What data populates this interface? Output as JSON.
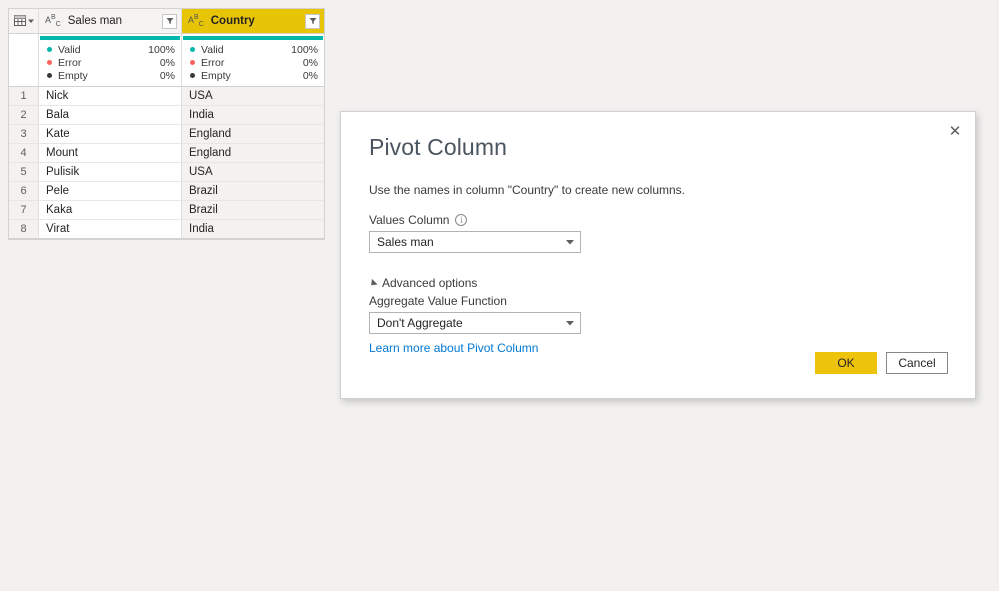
{
  "grid": {
    "table_icon_name": "table-icon",
    "columns": [
      {
        "name": "Sales man",
        "type_icon": "ABC",
        "selected": false,
        "quality": [
          {
            "label": "Valid",
            "value": "100%",
            "state": "valid"
          },
          {
            "label": "Error",
            "value": "0%",
            "state": "error"
          },
          {
            "label": "Empty",
            "value": "0%",
            "state": "empty"
          }
        ]
      },
      {
        "name": "Country",
        "type_icon": "ABC",
        "selected": true,
        "quality": [
          {
            "label": "Valid",
            "value": "100%",
            "state": "valid"
          },
          {
            "label": "Error",
            "value": "0%",
            "state": "error"
          },
          {
            "label": "Empty",
            "value": "0%",
            "state": "empty"
          }
        ]
      }
    ],
    "rows": [
      {
        "num": "1",
        "sales_man": "Nick",
        "country": "USA"
      },
      {
        "num": "2",
        "sales_man": "Bala",
        "country": "India"
      },
      {
        "num": "3",
        "sales_man": "Kate",
        "country": "England"
      },
      {
        "num": "4",
        "sales_man": "Mount",
        "country": "England"
      },
      {
        "num": "5",
        "sales_man": "Pulisik",
        "country": "USA"
      },
      {
        "num": "6",
        "sales_man": "Pele",
        "country": "Brazil"
      },
      {
        "num": "7",
        "sales_man": "Kaka",
        "country": "Brazil"
      },
      {
        "num": "8",
        "sales_man": "Virat",
        "country": "India"
      }
    ]
  },
  "dialog": {
    "title": "Pivot Column",
    "description": "Use the names in column \"Country\" to create new columns.",
    "values_column": {
      "label": "Values Column",
      "info_icon": "info-icon",
      "selected": "Sales man"
    },
    "advanced": {
      "toggle_label": "Advanced options",
      "expanded": true,
      "aggregate_label": "Aggregate Value Function",
      "aggregate_selected": "Don't Aggregate"
    },
    "learn_more": "Learn more about Pivot Column",
    "ok_label": "OK",
    "cancel_label": "Cancel",
    "close_icon": "✕"
  },
  "colors": {
    "accent_yellow": "#eec30b",
    "quality_valid": "#01b8aa",
    "quality_error": "#fd625e",
    "quality_empty": "#3b3a39",
    "link_blue": "#0078d4",
    "page_background": "#f2f1f0"
  }
}
